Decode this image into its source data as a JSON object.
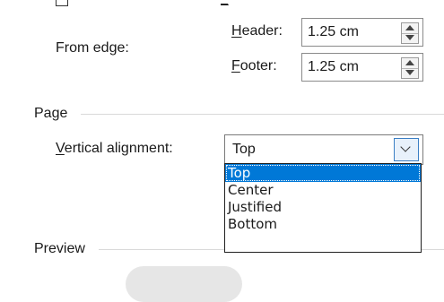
{
  "margins": {
    "from_edge_label": "From edge:",
    "header_label_first": "H",
    "header_label_rest": "eader:",
    "header_value": "1.25 cm",
    "footer_label_first": "F",
    "footer_label_rest": "ooter:",
    "footer_value": "1.25 cm"
  },
  "page_section": {
    "title": "Page",
    "vertical_alignment_label_first": "V",
    "vertical_alignment_label_rest": "ertical alignment:",
    "vertical_alignment_value": "Top",
    "options": [
      {
        "label": "Top",
        "selected": true
      },
      {
        "label": "Center",
        "selected": false
      },
      {
        "label": "Justified",
        "selected": false
      },
      {
        "label": "Bottom",
        "selected": false
      }
    ]
  },
  "preview_section": {
    "title": "Preview"
  },
  "colors": {
    "selection": "#0078d7",
    "accent_border": "#3b7fc4"
  }
}
